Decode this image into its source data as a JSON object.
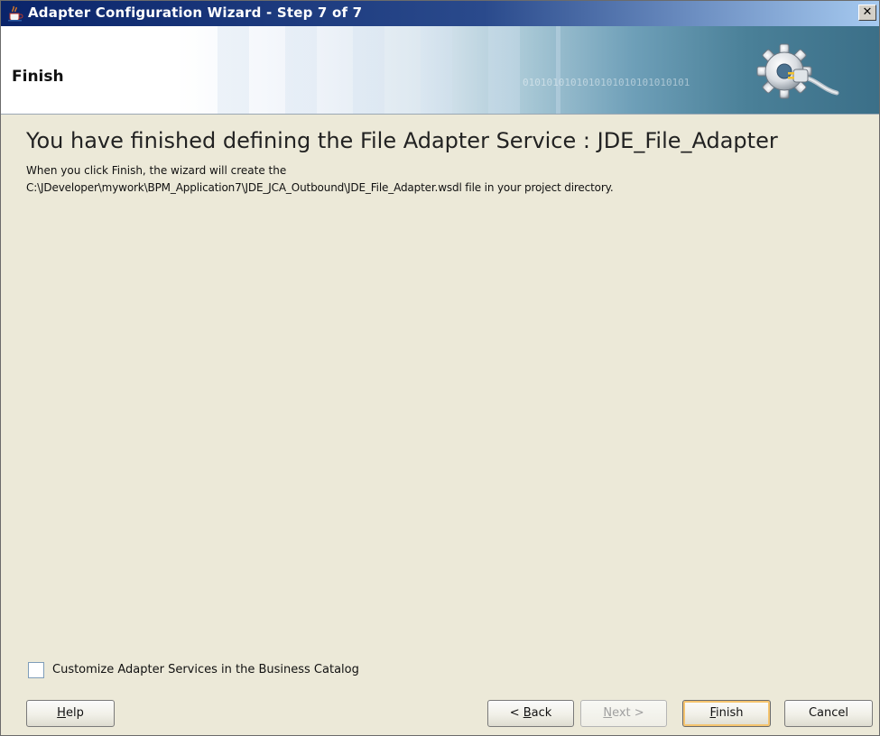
{
  "window": {
    "title": "Adapter Configuration Wizard - Step 7 of 7",
    "close_glyph": "✕"
  },
  "banner": {
    "title": "Finish",
    "binary_text": "0101010101010101010101010101"
  },
  "content": {
    "headline": "You have finished defining the File Adapter Service : JDE_File_Adapter",
    "description_line1": "When you click Finish, the wizard will create the",
    "description_line2": "C:\\JDeveloper\\mywork\\BPM_Application7\\JDE_JCA_Outbound\\JDE_File_Adapter.wsdl file in your project directory."
  },
  "options": {
    "customize_label": "Customize Adapter Services in the Business Catalog",
    "customize_checked": false
  },
  "buttons": {
    "help": {
      "mnemonic": "H",
      "rest": "elp"
    },
    "back": {
      "prefix": "< ",
      "mnemonic": "B",
      "rest": "ack"
    },
    "next": {
      "mnemonic": "N",
      "rest": "ext >",
      "enabled": false
    },
    "finish": {
      "mnemonic": "F",
      "rest": "inish",
      "default": true
    },
    "cancel": {
      "label": "Cancel"
    }
  },
  "icons": {
    "app": "coffee-cup-icon",
    "banner": "gear-plug-icon"
  },
  "colors": {
    "titlebar_start": "#0a246a",
    "titlebar_end": "#a6caf0",
    "dialog_bg": "#ece9d8",
    "default_button_highlight": "#f5c46e"
  }
}
